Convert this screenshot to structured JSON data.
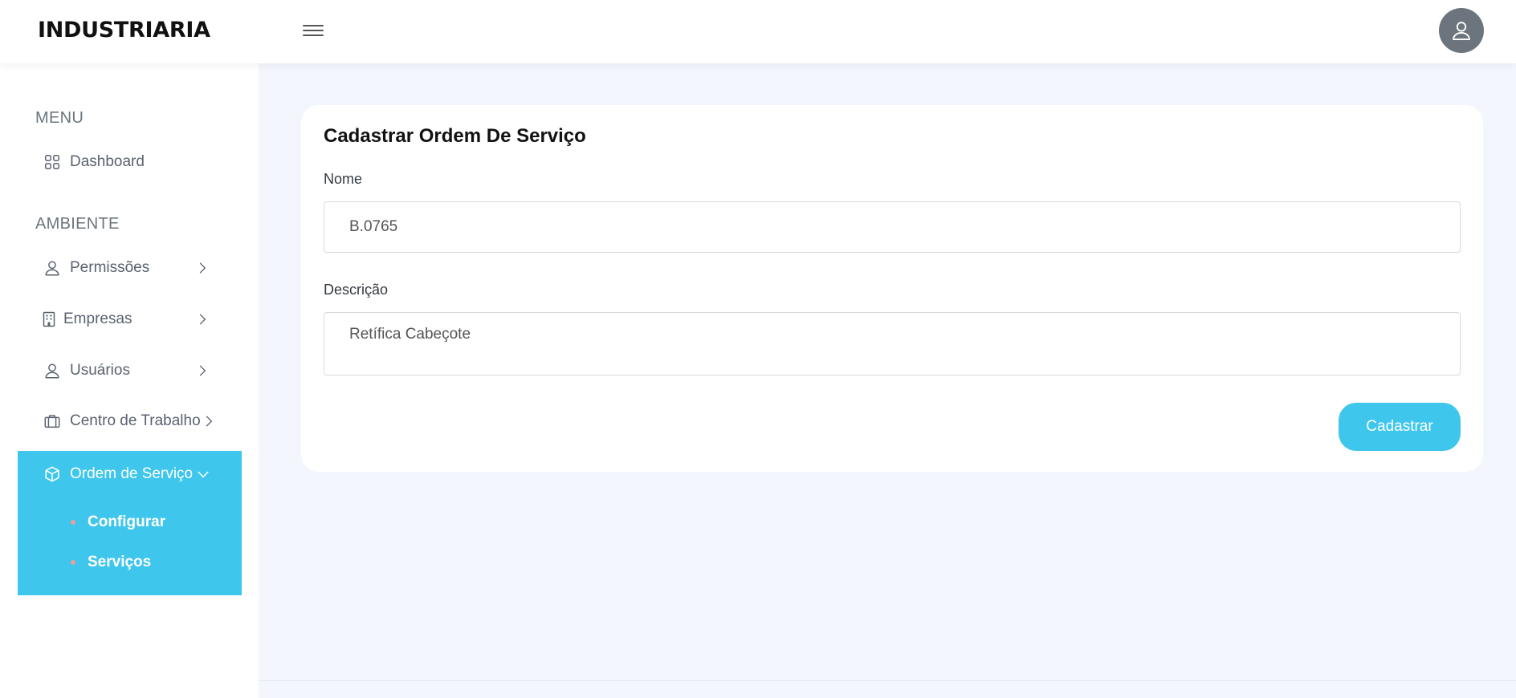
{
  "header": {
    "logo_text": "INDUSTRIARIA",
    "menu_icon": "hamburger-icon",
    "avatar_icon": "user-icon"
  },
  "sidebar": {
    "sections": [
      {
        "title": "MENU"
      },
      {
        "title": "AMBIENTE"
      }
    ],
    "items": [
      {
        "label": "Dashboard",
        "icon": "grid-icon"
      },
      {
        "label": "Permissões",
        "icon": "user-icon",
        "has_chevron": true
      },
      {
        "label": "Empresas",
        "icon": "building-icon",
        "has_chevron": true
      },
      {
        "label": "Usuários",
        "icon": "user-icon",
        "has_chevron": true
      },
      {
        "label": "Centro de Trabalho",
        "icon": "briefcase-icon",
        "has_chevron": true
      }
    ],
    "active_item": {
      "label": "Ordem de Serviço",
      "icon": "box-icon",
      "expanded": true,
      "children": [
        {
          "label": "Configurar"
        },
        {
          "label": "Serviços"
        }
      ]
    }
  },
  "form": {
    "title": "Cadastrar Ordem De Serviço",
    "name_label": "Nome",
    "name_value": "B.0765",
    "description_label": "Descrição",
    "description_value": "Retífica Cabeçote",
    "submit_label": "Cadastrar"
  },
  "colors": {
    "accent": "#3fc6ec",
    "page_background": "#f3f6fd",
    "avatar_background": "#6c757d"
  }
}
